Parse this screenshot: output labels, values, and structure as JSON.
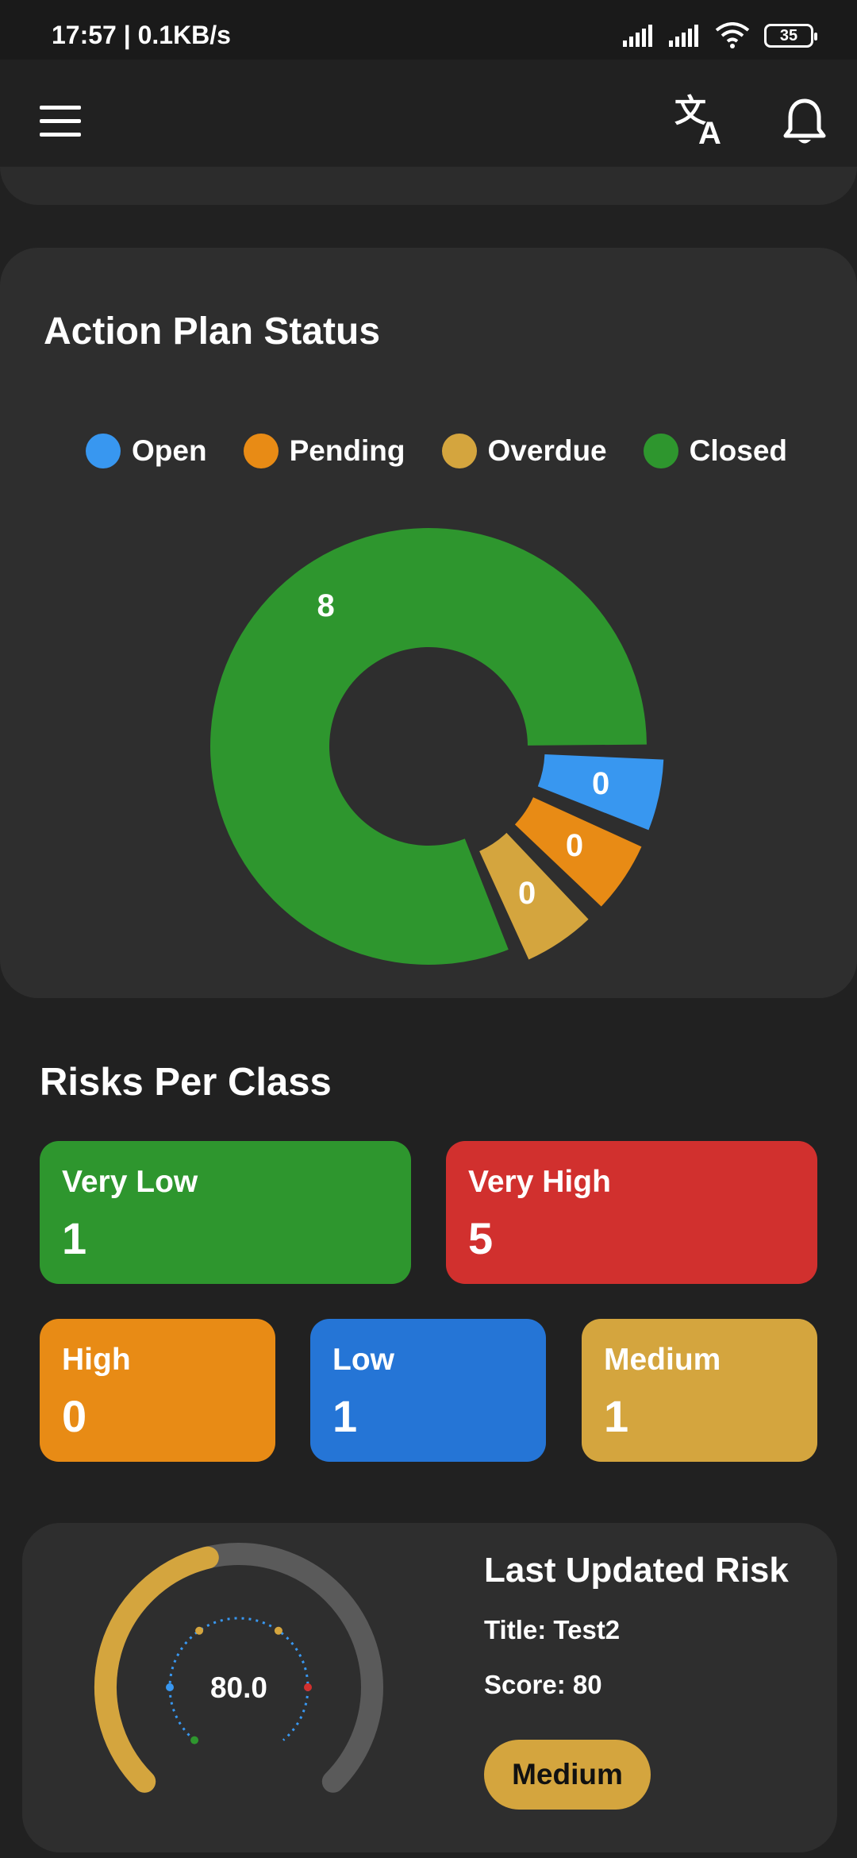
{
  "status_bar": {
    "time": "17:57 | 0.1KB/s",
    "battery": "35"
  },
  "app_bar": {
    "icons": [
      "menu-icon",
      "translate-icon",
      "bell-icon"
    ]
  },
  "action_plan": {
    "title": "Action Plan Status",
    "legend": [
      {
        "label": "Open",
        "color": "#3897f0"
      },
      {
        "label": "Pending",
        "color": "#e88b15"
      },
      {
        "label": "Overdue",
        "color": "#d4a53e"
      },
      {
        "label": "Closed",
        "color": "#2e962e"
      }
    ]
  },
  "chart_data": {
    "type": "pie",
    "categories": [
      "Open",
      "Pending",
      "Overdue",
      "Closed"
    ],
    "values": [
      0,
      0,
      0,
      8
    ],
    "colors": [
      "#3897f0",
      "#e88b15",
      "#d4a53e",
      "#2e962e"
    ],
    "title": "Action Plan Status",
    "legend_position": "top"
  },
  "risks_per_class": {
    "title": "Risks Per Class",
    "tiles": [
      {
        "label": "Very Low",
        "value": "1",
        "color": "#2e962e"
      },
      {
        "label": "Very High",
        "value": "5",
        "color": "#d1302e"
      },
      {
        "label": "High",
        "value": "0",
        "color": "#e88b15"
      },
      {
        "label": "Low",
        "value": "1",
        "color": "#2575d6"
      },
      {
        "label": "Medium",
        "value": "1",
        "color": "#d4a53e"
      }
    ]
  },
  "last_updated_risk": {
    "title": "Last Updated Risk",
    "risk_title": "Title: Test2",
    "score": "Score: 80",
    "gauge_value": "80.0",
    "gauge_fraction": 0.8,
    "class_label": "Medium",
    "gauge_color": "#d4a53e"
  }
}
